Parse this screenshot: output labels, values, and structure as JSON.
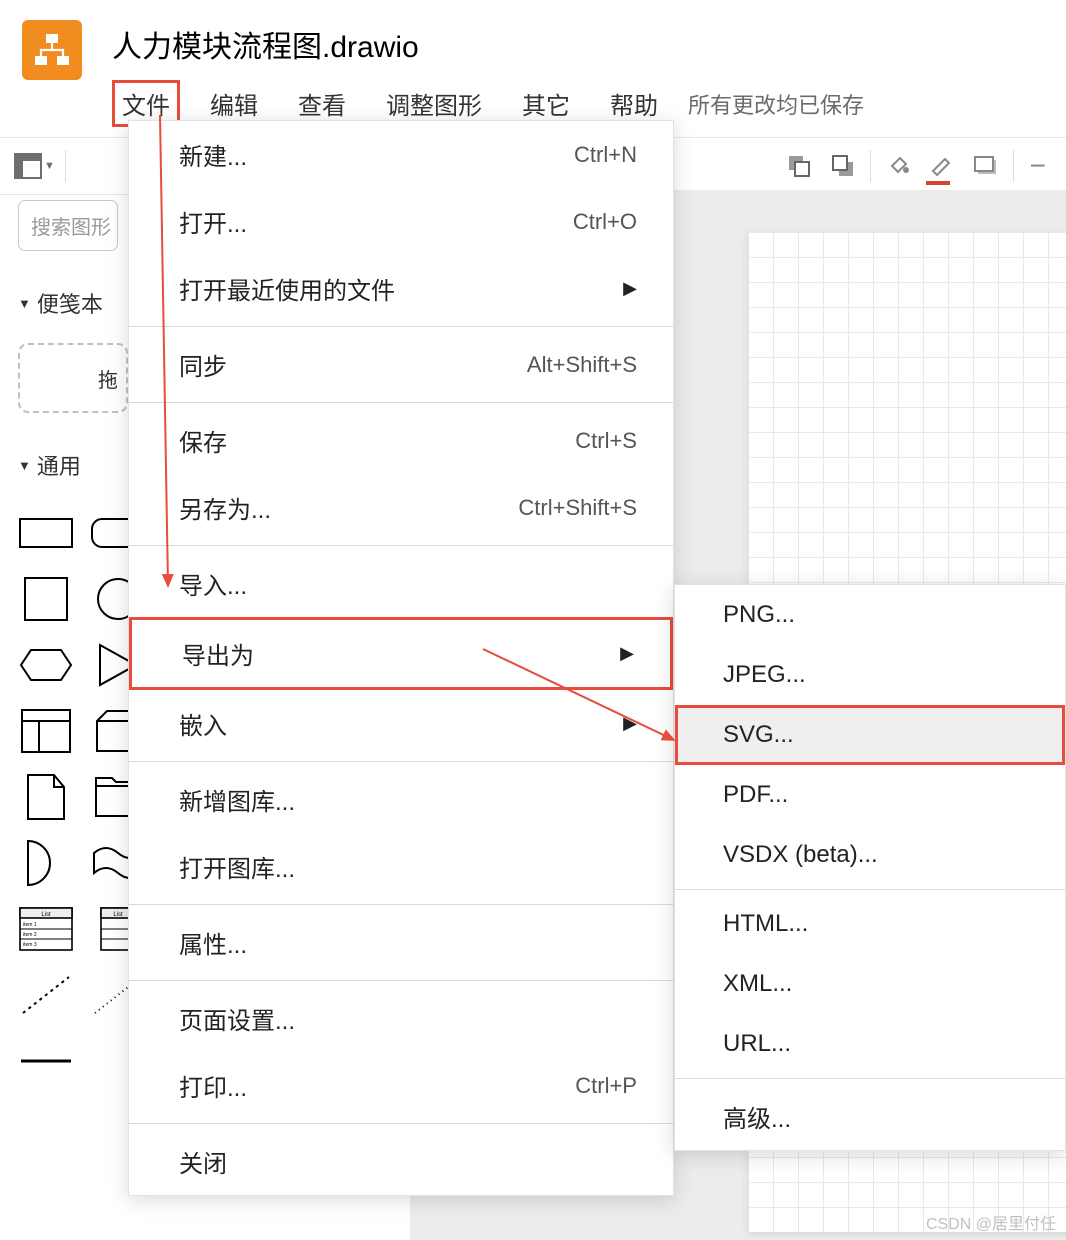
{
  "header": {
    "doc_title": "人力模块流程图.drawio",
    "menu": {
      "file": "文件",
      "edit": "编辑",
      "view": "查看",
      "shape": "调整图形",
      "other": "其它",
      "help": "帮助"
    },
    "save_status": "所有更改均已保存"
  },
  "left": {
    "search_placeholder": "搜索图形",
    "scratchpad": "便笺本",
    "scratch_hint": "拖",
    "general": "通用"
  },
  "dropdown": {
    "new": "新建...",
    "new_sc": "Ctrl+N",
    "open": "打开...",
    "open_sc": "Ctrl+O",
    "recent": "打开最近使用的文件",
    "sync": "同步",
    "sync_sc": "Alt+Shift+S",
    "save": "保存",
    "save_sc": "Ctrl+S",
    "saveas": "另存为...",
    "saveas_sc": "Ctrl+Shift+S",
    "import": "导入...",
    "export": "导出为",
    "embed": "嵌入",
    "newlib": "新增图库...",
    "openlib": "打开图库...",
    "props": "属性...",
    "pagesetup": "页面设置...",
    "print": "打印...",
    "print_sc": "Ctrl+P",
    "close": "关闭"
  },
  "submenu": {
    "png": "PNG...",
    "jpeg": "JPEG...",
    "svg": "SVG...",
    "pdf": "PDF...",
    "vsdx": "VSDX (beta)...",
    "html": "HTML...",
    "xml": "XML...",
    "url": "URL...",
    "advanced": "高级..."
  },
  "watermark": "CSDN @居里付任"
}
